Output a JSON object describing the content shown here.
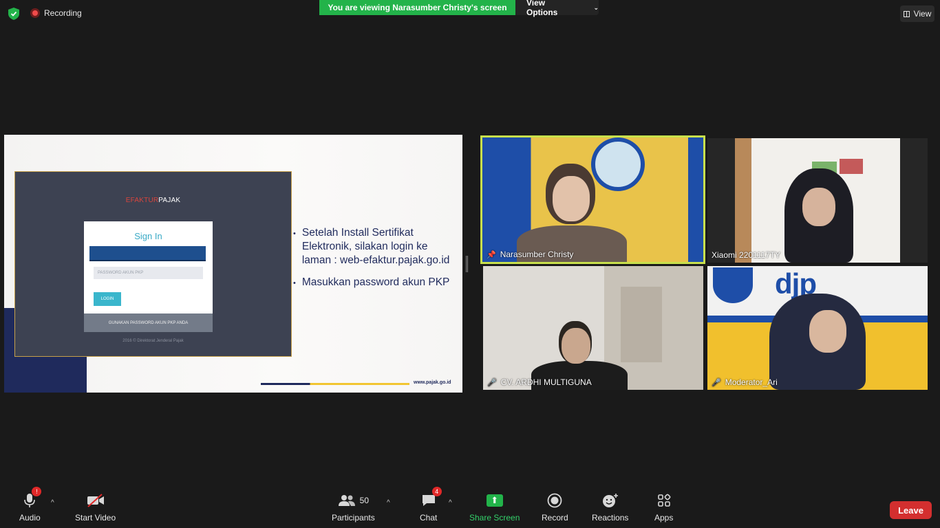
{
  "top": {
    "recording_label": "Recording",
    "viewing_banner": "You are viewing Narasumber Christy's screen",
    "view_options_label": "View Options",
    "view_button_label": "View"
  },
  "slide": {
    "login_brand_red": "EFAKTUR",
    "login_brand_white": "PAJAK",
    "login_title": "Sign In",
    "password_placeholder": "PASSWORD AKUN PKP",
    "login_button": "LOGIN",
    "login_footer": "GUNAKAN PASSWORD AKUN PKP ANDA",
    "login_copyright": "2016 © Direktorat Jenderal Pajak",
    "bullets": [
      "Setelah Install Sertifikat Elektronik, silakan login ke laman : web-efaktur.pajak.go.id",
      "Masukkan password akun PKP"
    ],
    "url": "www.pajak.go.id"
  },
  "participants": [
    {
      "name": "Narasumber Christy",
      "muted": false,
      "pinned": true,
      "active_speaker": true
    },
    {
      "name": "Xiaomi 2201117TY",
      "muted": false,
      "pinned": false
    },
    {
      "name": "CV. ARDHI MULTIGUNA",
      "muted": true,
      "pinned": false
    },
    {
      "name": "Moderator_Ari",
      "muted": true,
      "pinned": false
    }
  ],
  "tile4_logo_text": "djp",
  "toolbar": {
    "audio_label": "Audio",
    "audio_alert": "!",
    "video_label": "Start Video",
    "participants_label": "Participants",
    "participants_count": "50",
    "chat_label": "Chat",
    "chat_badge": "4",
    "share_label": "Share Screen",
    "record_label": "Record",
    "reactions_label": "Reactions",
    "apps_label": "Apps",
    "leave_label": "Leave"
  },
  "colors": {
    "banner_green": "#23b34a",
    "leave_red": "#d32f2f",
    "active_speaker_border": "#c8e04c",
    "slide_navy": "#1f2a5c"
  }
}
